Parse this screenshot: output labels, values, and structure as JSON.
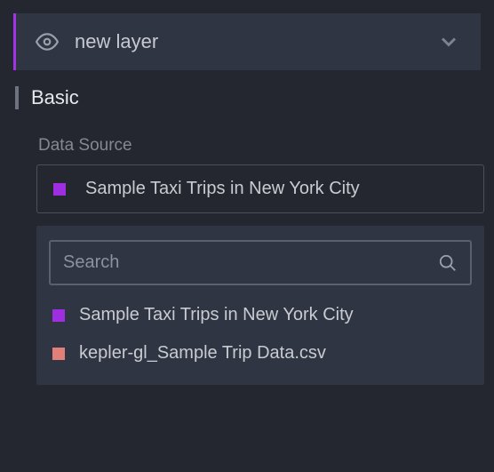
{
  "layer": {
    "title": "new layer"
  },
  "section": {
    "title": "Basic"
  },
  "dataSource": {
    "label": "Data Source",
    "selected": "Sample Taxi Trips in New York City",
    "searchPlaceholder": "Search",
    "options": [
      {
        "label": "Sample Taxi Trips in New York City",
        "color": "#9d2fe0"
      },
      {
        "label": "kepler-gl_Sample Trip Data.csv",
        "color": "#e18079"
      }
    ]
  }
}
